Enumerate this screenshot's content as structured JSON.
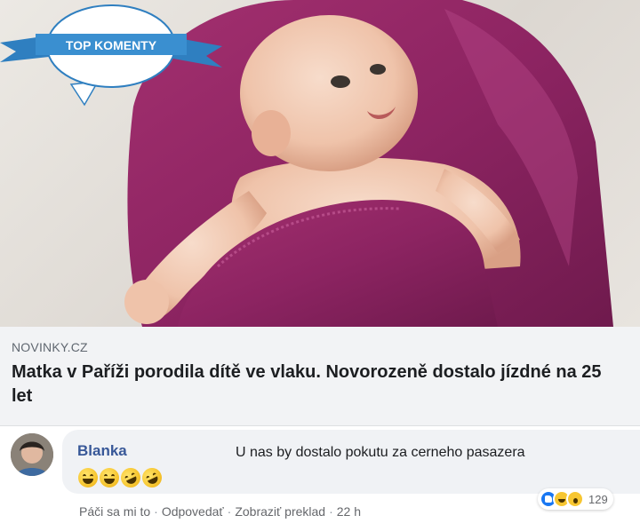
{
  "post": {
    "image": {
      "subject": "baby-photo",
      "badge_text": "TOP KOMENTY"
    },
    "link": {
      "source": "NOVINKY.CZ",
      "headline": "Matka v Paříži porodila dítě ve vlaku. Novorozeně dostalo jízdné na 25 let"
    }
  },
  "comment": {
    "author": "Blanka",
    "text": "U nas by dostalo pokutu za cerneho pasazera",
    "emojis": [
      "grinning-face-icon",
      "grinning-face-icon",
      "rolling-on-floor-laughing-icon",
      "rolling-on-floor-laughing-icon"
    ],
    "reactions": {
      "icons": [
        "like-icon",
        "haha-icon",
        "wow-icon"
      ],
      "count": "129"
    },
    "actions": {
      "like": "Páči sa mi to",
      "reply": "Odpovedať",
      "translate": "Zobraziť preklad",
      "time": "22 h",
      "separator": "·"
    }
  },
  "colors": {
    "author": "#385898",
    "blanket": "#9b2d6f",
    "badge": "#3a8fd0",
    "link_bg": "#f2f3f5"
  }
}
